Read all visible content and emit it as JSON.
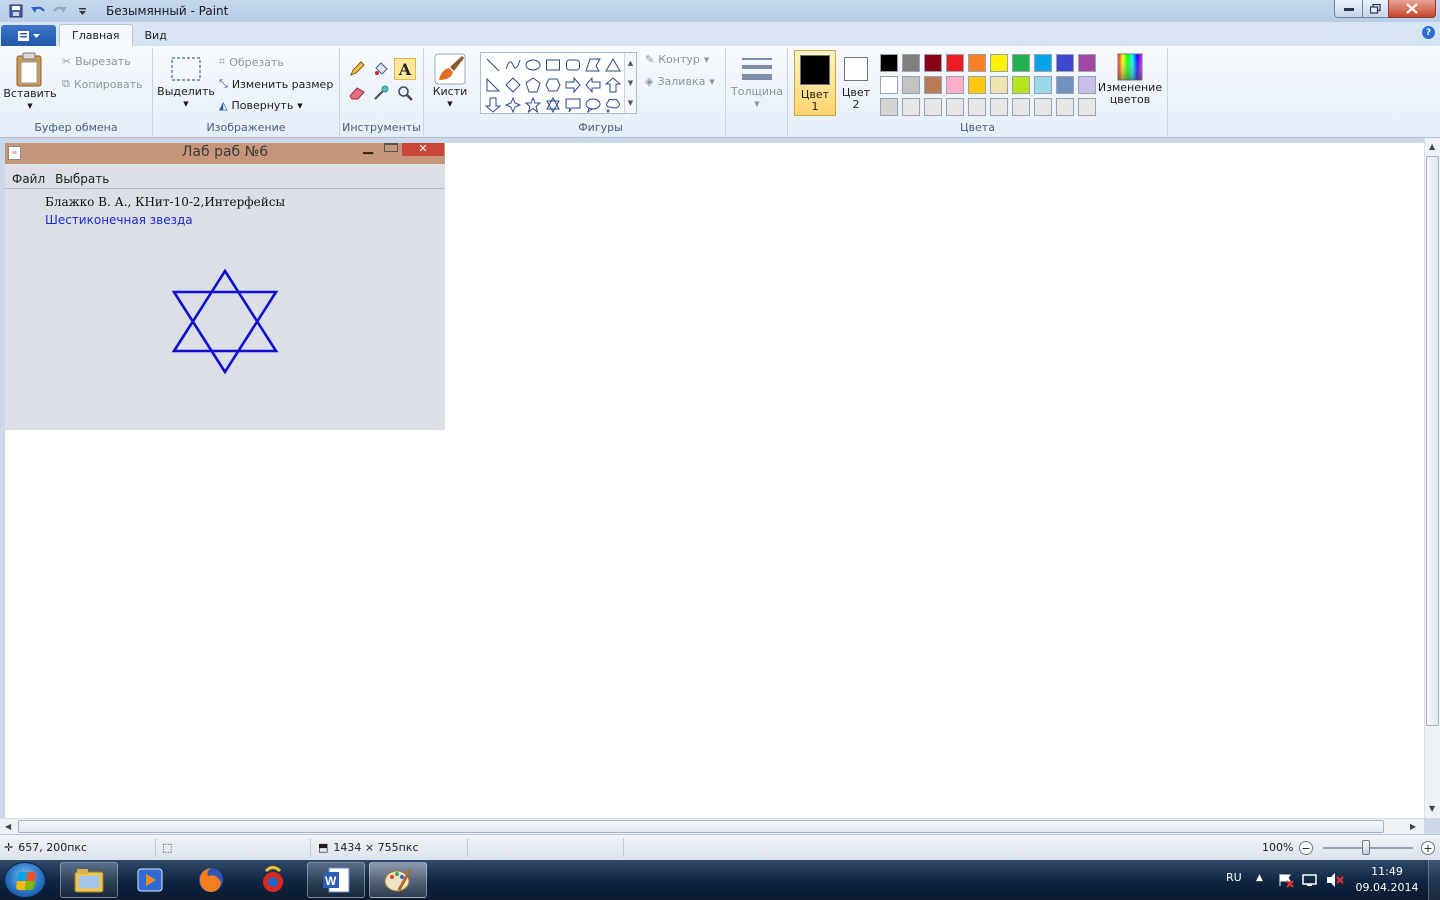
{
  "window": {
    "title": "Безымянный - Paint"
  },
  "tabs": {
    "file": "",
    "home": "Главная",
    "view": "Вид"
  },
  "clipboard": {
    "paste": "Вставить",
    "cut": "Вырезать",
    "copy": "Копировать",
    "label": "Буфер обмена"
  },
  "image": {
    "select": "Выделить",
    "crop": "Обрезать",
    "resize": "Изменить размер",
    "rotate": "Повернуть",
    "label": "Изображение"
  },
  "tools": {
    "label": "Инструменты",
    "brushes": "Кисти"
  },
  "shapes": {
    "outline": "Контур",
    "fill": "Заливка",
    "label": "Фигуры"
  },
  "size": {
    "label": "Толщина"
  },
  "colors": {
    "color1_label": "Цвет 1",
    "color2_label": "Цвет 2",
    "edit_label": "Изменение цветов",
    "label": "Цвета",
    "color1": "#000000",
    "color2": "#ffffff",
    "palette": [
      "#000000",
      "#7f7f7f",
      "#880015",
      "#ed1c24",
      "#ff7f27",
      "#fff200",
      "#22b14c",
      "#00a2e8",
      "#3f48cc",
      "#a349a4",
      "#ffffff",
      "#c3c3c3",
      "#b97a57",
      "#ffaec9",
      "#ffc90e",
      "#efe4b0",
      "#b5e61d",
      "#99d9ea",
      "#7092be",
      "#c8bfe7",
      "#d4d4d4",
      "#e6e6e6",
      "#e6e6e6",
      "#e6e6e6",
      "#e6e6e6",
      "#e6e6e6",
      "#e6e6e6",
      "#e6e6e6",
      "#e6e6e6",
      "#e6e6e6"
    ]
  },
  "java_window": {
    "title": "Лаб раб №6",
    "menu": [
      "Файл",
      "Выбрать"
    ],
    "author": "Блажко В. А., КНит-10-2,Интерфейсы",
    "caption": "Шестиконечная звезда",
    "star_color": "#1010d0"
  },
  "status": {
    "cursor_pos": "657, 200пкс",
    "image_size": "1434 × 755пкс",
    "zoom": "100%"
  },
  "taskbar": {
    "lang": "RU",
    "time": "11:49",
    "date": "09.04.2014"
  }
}
